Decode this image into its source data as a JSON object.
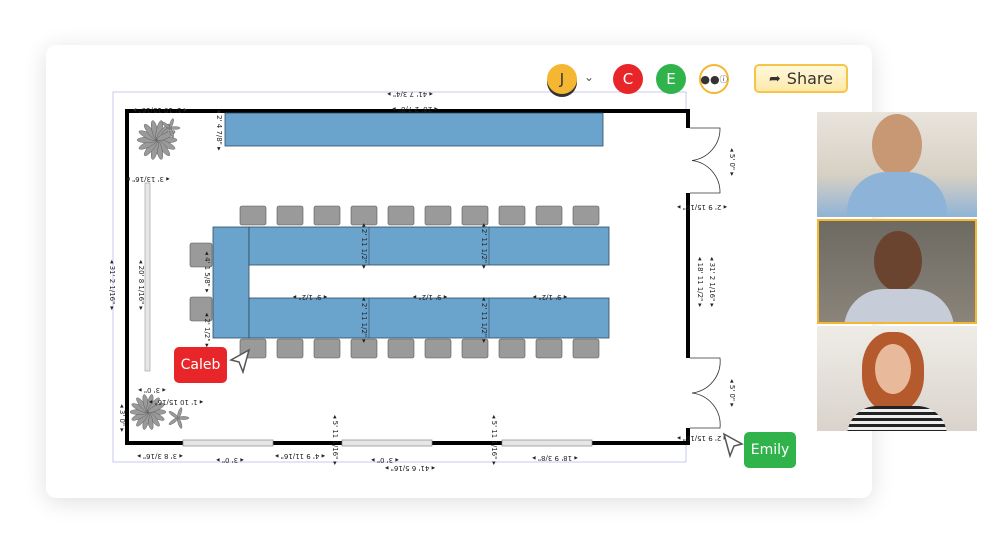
{
  "toolbar": {
    "collaborators": [
      {
        "initial": "J",
        "color": "#f5b731"
      },
      {
        "initial": "C",
        "color": "#e8262a"
      },
      {
        "initial": "E",
        "color": "#2fb34a"
      }
    ],
    "share_label": "Share",
    "share_icon": "share-icon",
    "participants_icon": "participants-info-icon"
  },
  "floorplan": {
    "dimensions": {
      "overall_width_top": "41' 7 3/4\"",
      "top_table_width": "28' 2 7/8\"",
      "top_table_depth": "2' 4 7/8\"",
      "top_left_offset": "1' 10 15/16\"",
      "left_window": "3' 13/16\"",
      "left_height": "31' 2 1/16\"",
      "left_inner": "20' 8 1/16\"",
      "u_table_left": "4' 1 5/8\"",
      "seat_gap": "9' 1/2\"",
      "u_table_depth": "2' 11 1/2\"",
      "u_side": "2' 1/2\"",
      "bottom_left_a": "3' 0\"",
      "bottom_left_b": "1' 10 15/16\"",
      "bottom_left_c": "3' 0\"",
      "bottom_seg_1": "3' 8 3/16\"",
      "bottom_window": "3' 0\"",
      "bottom_seg_2": "4' 9 11/16\"",
      "bottom_seg_3": "18' 9 3/8\"",
      "bottom_vertical": "5' 11 1/16\"",
      "overall_width_bottom": "41' 6 5/16\"",
      "door_width": "5' 0\"",
      "door_offset": "2' 9 15/16\"",
      "right_wall": "18' 11 1/2\"",
      "right_height": "31' 2 1/16\""
    },
    "colors": {
      "table": "#6aa3cc",
      "chair": "#9a9a9a",
      "wall": "#000000"
    }
  },
  "cursors": [
    {
      "name": "Caleb",
      "color": "#e8262a"
    },
    {
      "name": "Emily",
      "color": "#2fb34a"
    }
  ],
  "video_call": {
    "participants": 3,
    "active_border": "#f5b731"
  }
}
